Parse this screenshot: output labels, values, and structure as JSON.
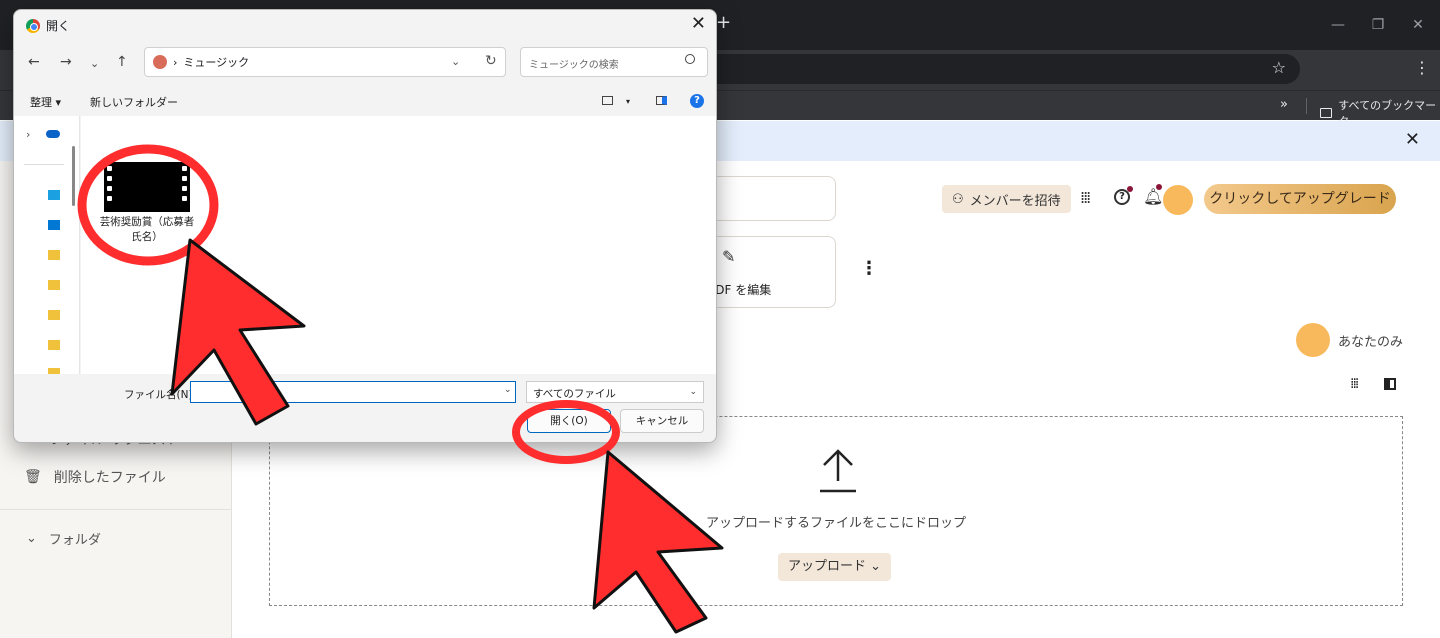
{
  "browser": {
    "bookmarks_overflow": "»",
    "all_bookmarks": "すべてのブックマーク",
    "star": "☆",
    "menu": "⋮",
    "new_tab": "+",
    "window_minimize": "—",
    "window_restore": "❐",
    "window_close": "✕"
  },
  "info_bar": {
    "close": "✕"
  },
  "app": {
    "invite_label": "メンバーを招待",
    "upgrade_label": "クリックしてアップグレード",
    "edit_pdf_label": "PDF を編集",
    "owner_label": "あなたのみ",
    "dropzone_text": "アップロードするファイルをここにドロップ",
    "upload_button": "アップロード",
    "sidebar": {
      "items": [
        {
          "label": "ファイル リクエスト"
        },
        {
          "label": "削除したファイル"
        }
      ],
      "folder_section": "フォルダ"
    },
    "colors": {
      "accent": "#f3e7da",
      "avatar": "#f8b95c",
      "upgrade": "#d9a44e"
    }
  },
  "dialog": {
    "title": "開く",
    "close": "✕",
    "path": "ミュージック",
    "search_placeholder": "ミュージックの検索",
    "organize": "整理 ▾",
    "new_folder": "新しいフォルダー",
    "file": {
      "name": "芸術奨励賞（応募者氏名）"
    },
    "filename_label": "ファイル名(N):",
    "filename_value": "",
    "filter_value": "すべてのファイル",
    "open_button": "開く(O)",
    "cancel_button": "キャンセル"
  },
  "annotations": {
    "color": "#ff2d2d"
  }
}
